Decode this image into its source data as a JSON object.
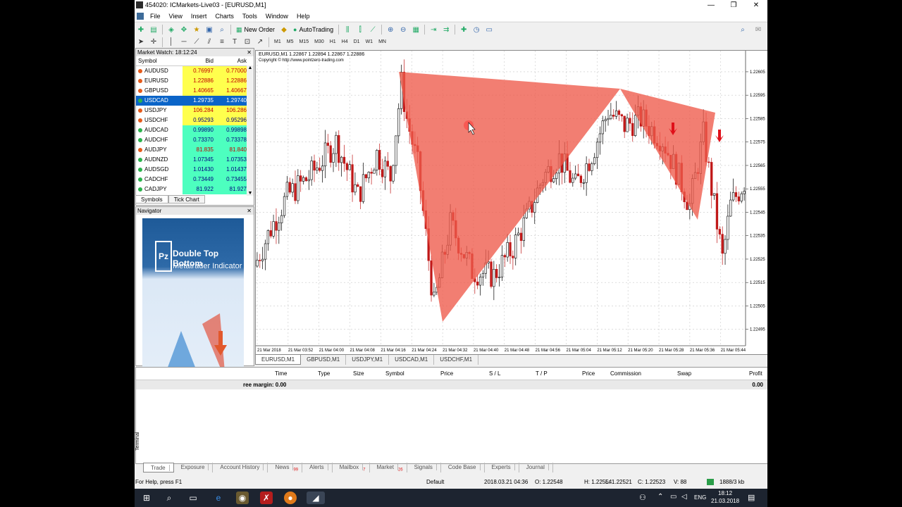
{
  "window": {
    "title": "454020: ICMarkets-Live03 - [EURUSD,M1]",
    "controls": [
      "—",
      "❐",
      "✕"
    ]
  },
  "menu": [
    "File",
    "View",
    "Insert",
    "Charts",
    "Tools",
    "Window",
    "Help"
  ],
  "toolbar": {
    "new_order": "New Order",
    "autotrading": "AutoTrading",
    "timeframes": [
      "M1",
      "M5",
      "M15",
      "M30",
      "H1",
      "H4",
      "D1",
      "W1",
      "MN"
    ]
  },
  "market_watch": {
    "title": "Market Watch: 18:12:24",
    "headers": [
      "Symbol",
      "Bid",
      "Ask"
    ],
    "rows": [
      {
        "symbol": "AUDUSD",
        "bid": "0.76997",
        "ask": "0.77000",
        "bg": "#ffff4d",
        "color": "#c00000",
        "dot": "#e55b1b"
      },
      {
        "symbol": "EURUSD",
        "bid": "1.22886",
        "ask": "1.22886",
        "bg": "#ffff4d",
        "color": "#c00000",
        "dot": "#e55b1b"
      },
      {
        "symbol": "GBPUSD",
        "bid": "1.40665",
        "ask": "1.40667",
        "bg": "#ffff4d",
        "color": "#c00000",
        "dot": "#e55b1b"
      },
      {
        "symbol": "USDCAD",
        "bid": "1.29735",
        "ask": "1.29740",
        "bg": "#0a64c8",
        "color": "#ffffff",
        "dot": "#2bb24c"
      },
      {
        "symbol": "USDJPY",
        "bid": "106.284",
        "ask": "106.286",
        "bg": "#ffff4d",
        "color": "#c00000",
        "dot": "#e55b1b"
      },
      {
        "symbol": "USDCHF",
        "bid": "0.95293",
        "ask": "0.95296",
        "bg": "#ffff4d",
        "color": "#000080",
        "dot": "#e55b1b"
      },
      {
        "symbol": "AUDCAD",
        "bid": "0.99890",
        "ask": "0.99898",
        "bg": "#4dffbf",
        "color": "#000080",
        "dot": "#2bb24c"
      },
      {
        "symbol": "AUDCHF",
        "bid": "0.73370",
        "ask": "0.73378",
        "bg": "#4dffbf",
        "color": "#000080",
        "dot": "#2bb24c"
      },
      {
        "symbol": "AUDJPY",
        "bid": "81.835",
        "ask": "81.840",
        "bg": "#4dffbf",
        "color": "#c00000",
        "dot": "#e55b1b"
      },
      {
        "symbol": "AUDNZD",
        "bid": "1.07345",
        "ask": "1.07353",
        "bg": "#4dffbf",
        "color": "#000080",
        "dot": "#2bb24c"
      },
      {
        "symbol": "AUDSGD",
        "bid": "1.01430",
        "ask": "1.01437",
        "bg": "#4dffbf",
        "color": "#000080",
        "dot": "#2bb24c"
      },
      {
        "symbol": "CADCHF",
        "bid": "0.73449",
        "ask": "0.73455",
        "bg": "#4dffbf",
        "color": "#000080",
        "dot": "#2bb24c"
      },
      {
        "symbol": "CADJPY",
        "bid": "81.922",
        "ask": "81.927",
        "bg": "#4dffbf",
        "color": "#000080",
        "dot": "#2bb24c"
      }
    ],
    "tabs": [
      "Symbols",
      "Tick Chart"
    ]
  },
  "navigator": {
    "title": "Navigator"
  },
  "promo": {
    "logo": "Pz",
    "line1": "Double Top Bottom",
    "line2": "Metatrader Indicator"
  },
  "chart": {
    "info": "EURUSD,M1  1.22867 1.22894 1.22867 1.22886",
    "copyright": "Copyright © http://www.pointzero-trading.com",
    "price_labels": [
      "1.22605",
      "1.22595",
      "1.22585",
      "1.22575",
      "1.22565",
      "1.22555",
      "1.22545",
      "1.22535",
      "1.22525",
      "1.22515",
      "1.22505",
      "1.22495"
    ],
    "time_labels": [
      "21 Mar 2018",
      "21 Mar 03:52",
      "21 Mar 04:00",
      "21 Mar 04:08",
      "21 Mar 04:16",
      "21 Mar 04:24",
      "21 Mar 04:32",
      "21 Mar 04:40",
      "21 Mar 04:48",
      "21 Mar 04:56",
      "21 Mar 05:04",
      "21 Mar 05:12",
      "21 Mar 05:20",
      "21 Mar 05:28",
      "21 Mar 05:36",
      "21 Mar 05:44"
    ],
    "tabs": [
      "EURUSD,M1",
      "GBPUSD,M1",
      "USDJPY,M1",
      "USDCAD,M1",
      "USDCHF,M1"
    ],
    "bear_color": "#c01818",
    "bull_color": "#000000",
    "pattern_color": "#ee5a4a"
  },
  "terminal": {
    "headers": [
      "Time",
      "Type",
      "Size",
      "Symbol",
      "Price",
      "S / L",
      "T / P",
      "Price",
      "Commission",
      "Swap",
      "Profit"
    ],
    "balance_text": "ree margin: 0.00",
    "profit": "0.00",
    "side_label": "Terminal",
    "tabs": [
      {
        "label": "Trade",
        "badge": ""
      },
      {
        "label": "Exposure",
        "badge": ""
      },
      {
        "label": "Account History",
        "badge": ""
      },
      {
        "label": "News",
        "badge": "99"
      },
      {
        "label": "Alerts",
        "badge": ""
      },
      {
        "label": "Mailbox",
        "badge": "7"
      },
      {
        "label": "Market",
        "badge": "26"
      },
      {
        "label": "Signals",
        "badge": ""
      },
      {
        "label": "Code Base",
        "badge": ""
      },
      {
        "label": "Experts",
        "badge": ""
      },
      {
        "label": "Journal",
        "badge": ""
      }
    ]
  },
  "status": {
    "help": "For Help, press F1",
    "profile": "Default",
    "datetime": "2018.03.21 04:36",
    "open": "O: 1.22548",
    "high": "H: 1.22554",
    "low": "L: 1.22521",
    "close": "C: 1.22523",
    "volume": "V: 88",
    "traffic": "1888/3 kb"
  },
  "taskbar": {
    "lang": "ENG",
    "time": "18:12",
    "date": "21.03.2018"
  }
}
